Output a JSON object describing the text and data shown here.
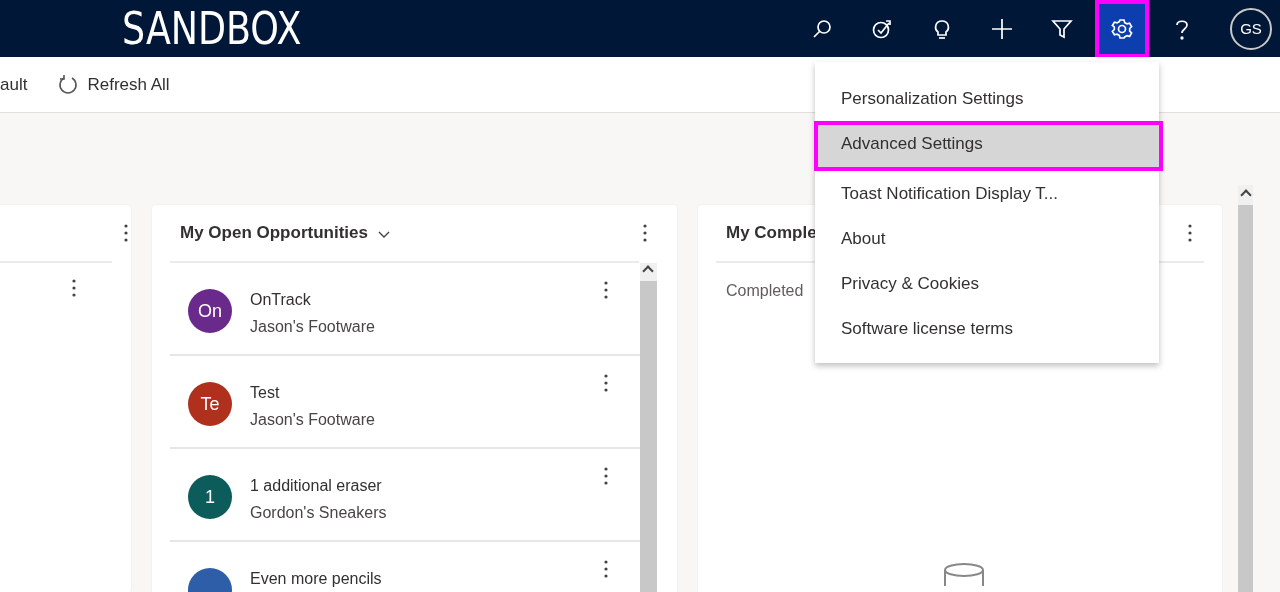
{
  "header": {
    "title": "SANDBOX",
    "buttons": [
      {
        "kind": "search",
        "active": false,
        "highlighted": false
      },
      {
        "kind": "target",
        "active": false,
        "highlighted": false
      },
      {
        "kind": "lightbulb",
        "active": false,
        "highlighted": false
      },
      {
        "kind": "plus",
        "active": false,
        "highlighted": false
      },
      {
        "kind": "filter",
        "active": false,
        "highlighted": false
      },
      {
        "kind": "settings",
        "active": true,
        "highlighted": true
      },
      {
        "kind": "help",
        "active": false,
        "highlighted": false
      }
    ],
    "avatar": {
      "initials": "GS"
    }
  },
  "toolbar": [
    {
      "kind": "text",
      "label": "ault"
    },
    {
      "kind": "refresh",
      "label": "Refresh All"
    }
  ],
  "cards": [
    {
      "kind": "blank"
    },
    {
      "kind": "list",
      "title": "My Open Opportunities",
      "items": [
        {
          "initials": "On",
          "color": "#6a2a8c",
          "title": "OnTrack",
          "subtitle": "Jason's Footware"
        },
        {
          "initials": "Te",
          "color": "#b0301e",
          "title": "Test",
          "subtitle": "Jason's Footware"
        },
        {
          "initials": "1",
          "color": "#0b5c5a",
          "title": "1 additional eraser",
          "subtitle": "Gordon's Sneakers"
        },
        {
          "color": "#2f5ea8",
          "title": "Even more pencils"
        }
      ]
    },
    {
      "kind": "empty",
      "title": "My Comple",
      "message": "Completed"
    }
  ],
  "menu": {
    "items": [
      {
        "label": "Personalization Settings",
        "highlighted": false
      },
      {
        "label": "Advanced Settings",
        "highlighted": true
      },
      {
        "label": "Toast Notification Display T...",
        "highlighted": false
      },
      {
        "label": "About",
        "highlighted": false
      },
      {
        "label": "Privacy & Cookies",
        "highlighted": false
      },
      {
        "label": "Software license terms",
        "highlighted": false
      }
    ]
  }
}
